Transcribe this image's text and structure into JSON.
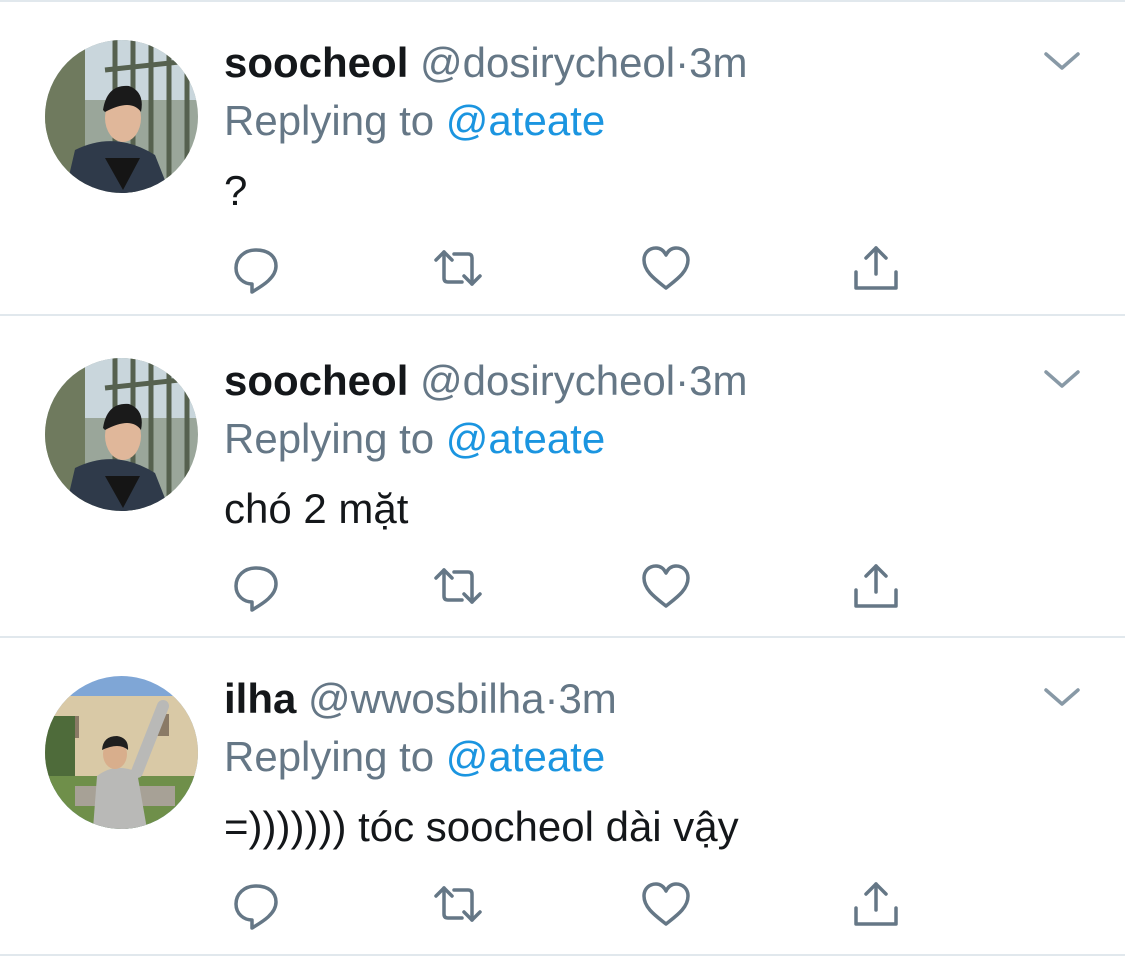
{
  "tweets": [
    {
      "name": "soocheol",
      "handle": "@dosirycheol",
      "separator": "·",
      "time": "3m",
      "replying_prefix": "Replying to ",
      "replying_to": "@ateate",
      "text": "?",
      "avatar": "avatar-soocheol"
    },
    {
      "name": "soocheol",
      "handle": "@dosirycheol",
      "separator": "·",
      "time": "3m",
      "replying_prefix": "Replying to ",
      "replying_to": "@ateate",
      "text": "chó 2 mặt",
      "avatar": "avatar-soocheol"
    },
    {
      "name": "ilha",
      "handle": "@wwosbilha",
      "separator": "·",
      "time": "3m",
      "replying_prefix": "Replying to ",
      "replying_to": "@ateate",
      "text": "=))))))) tóc soocheol dài vậy",
      "avatar": "avatar-ilha"
    }
  ],
  "actions": [
    "reply-icon",
    "retweet-icon",
    "like-icon",
    "share-icon"
  ],
  "colors": {
    "text": "#14171a",
    "secondary": "#657786",
    "link": "#1b95e0",
    "divider": "#e1e8ed"
  }
}
